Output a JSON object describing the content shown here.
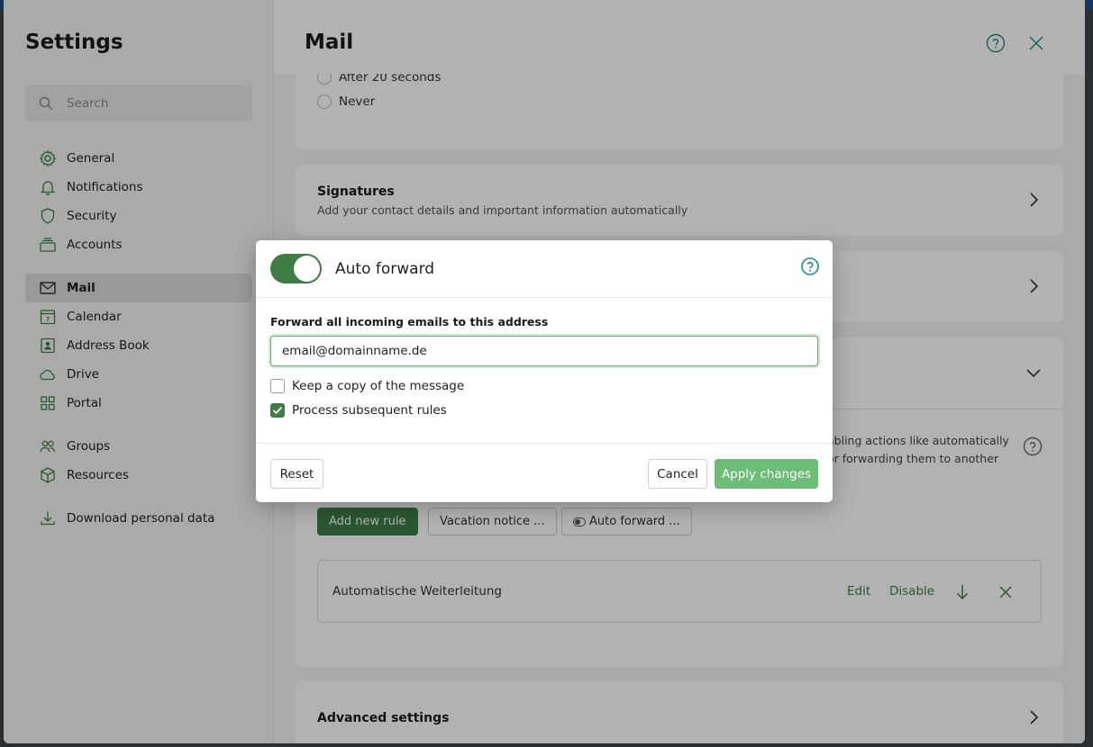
{
  "sidebar": {
    "title": "Settings",
    "search_placeholder": "Search",
    "items": [
      {
        "label": "General",
        "icon": "gear-icon"
      },
      {
        "label": "Notifications",
        "icon": "bell-icon"
      },
      {
        "label": "Security",
        "icon": "shield-icon"
      },
      {
        "label": "Accounts",
        "icon": "accounts-icon"
      },
      {
        "label": "Mail",
        "icon": "mail-icon",
        "active": true
      },
      {
        "label": "Calendar",
        "icon": "calendar-icon",
        "badge": "7"
      },
      {
        "label": "Address Book",
        "icon": "address-book-icon"
      },
      {
        "label": "Drive",
        "icon": "cloud-icon"
      },
      {
        "label": "Portal",
        "icon": "grid-icon"
      },
      {
        "label": "Groups",
        "icon": "groups-icon"
      },
      {
        "label": "Resources",
        "icon": "cube-icon"
      },
      {
        "label": "Download personal data",
        "icon": "download-icon"
      }
    ]
  },
  "main": {
    "title": "Mail",
    "radio_options": [
      "After 20 seconds",
      "Never"
    ],
    "signatures": {
      "title": "Signatures",
      "subtitle": "Add your contact details and important information automatically"
    },
    "rules": {
      "description_line1": "abling actions like automatically",
      "description_line2": "or forwarding them to another",
      "add_rule_label": "Add new rule",
      "vacation_label": "Vacation notice ...",
      "auto_forward_label": "Auto forward ...",
      "rule_name": "Automatische Weiterleitung",
      "edit_label": "Edit",
      "disable_label": "Disable"
    },
    "advanced": {
      "title": "Advanced settings"
    }
  },
  "modal": {
    "title": "Auto forward",
    "toggle_on": true,
    "field_label": "Forward all incoming emails to this address",
    "email_value": "email@domainname.de",
    "keep_copy_label": "Keep a copy of the message",
    "keep_copy_checked": false,
    "process_rules_label": "Process subsequent rules",
    "process_rules_checked": true,
    "reset_label": "Reset",
    "cancel_label": "Cancel",
    "apply_label": "Apply changes"
  },
  "colors": {
    "accent": "#3e7d45",
    "accent_light": "#6cbd75",
    "help_teal": "#1e8c8c"
  }
}
